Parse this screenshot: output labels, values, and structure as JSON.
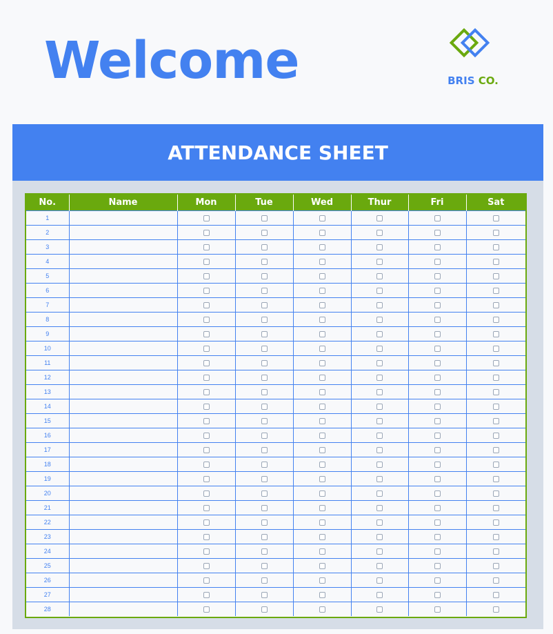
{
  "header": {
    "title": "Welcome"
  },
  "logo": {
    "name_part1": "BRIS",
    "name_part2": "CO.",
    "colors": {
      "green": "#6aa90e",
      "blue": "#4381f0"
    }
  },
  "sheet": {
    "title": "ATTENDANCE SHEET"
  },
  "table": {
    "columns": [
      "No.",
      "Name",
      "Mon",
      "Tue",
      "Wed",
      "Thur",
      "Fri",
      "Sat"
    ],
    "rows": [
      "1",
      "2",
      "3",
      "4",
      "5",
      "6",
      "7",
      "8",
      "9",
      "10",
      "11",
      "12",
      "13",
      "14",
      "15",
      "16",
      "17",
      "18",
      "19",
      "20",
      "21",
      "22",
      "23",
      "24",
      "25",
      "26",
      "27",
      "28"
    ]
  },
  "colors": {
    "accent_blue": "#4381f0",
    "accent_green": "#6aa90e",
    "panel": "#d6dde7"
  }
}
